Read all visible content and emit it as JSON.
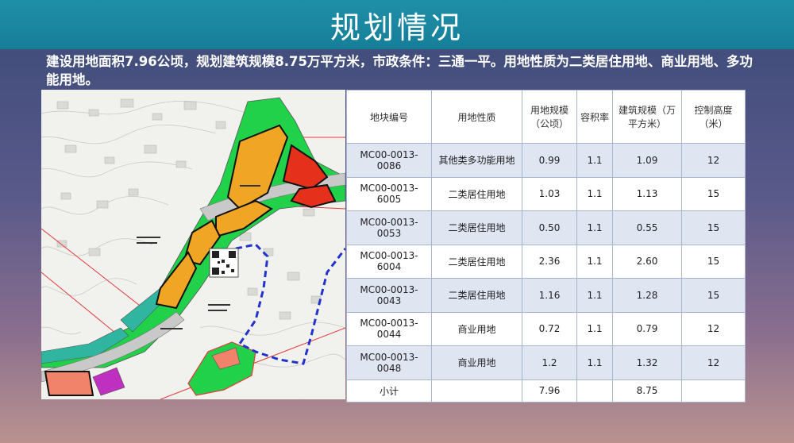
{
  "title": "规划情况",
  "description": "建设用地面积7.96公顷，规划建筑规模8.75万平方米，市政条件：三通一平。用地性质为二类居住用地、商业用地、多功能用地。",
  "table": {
    "headers": [
      "地块编号",
      "用地性质",
      "用地规模（公顷）",
      "容积率",
      "建筑规模（万平方米）",
      "控制高度（米）"
    ],
    "rows": [
      {
        "code": "MC00-0013-0086",
        "type": "其他类多功能用地",
        "area": "0.99",
        "far": "1.1",
        "gfa": "1.09",
        "height": "12"
      },
      {
        "code": "MC00-0013-6005",
        "type": "二类居住用地",
        "area": "1.03",
        "far": "1.1",
        "gfa": "1.13",
        "height": "15"
      },
      {
        "code": "MC00-0013-0053",
        "type": "二类居住用地",
        "area": "0.50",
        "far": "1.1",
        "gfa": "0.55",
        "height": "15"
      },
      {
        "code": "MC00-0013-6004",
        "type": "二类居住用地",
        "area": "2.36",
        "far": "1.1",
        "gfa": "2.60",
        "height": "15"
      },
      {
        "code": "MC00-0013-0043",
        "type": "二类居住用地",
        "area": "1.16",
        "far": "1.1",
        "gfa": "1.28",
        "height": "15"
      },
      {
        "code": "MC00-0013-0044",
        "type": "商业用地",
        "area": "0.72",
        "far": "1.1",
        "gfa": "0.79",
        "height": "12"
      },
      {
        "code": "MC00-0013-0048",
        "type": "商业用地",
        "area": "1.2",
        "far": "1.1",
        "gfa": "1.32",
        "height": "12"
      }
    ],
    "subtotal": {
      "label": "小计",
      "area": "7.96",
      "gfa": "8.75"
    }
  },
  "colors": {
    "title_bar": "#1f8fa8",
    "green_land": "#22d14a",
    "residential": "#f0a624",
    "commercial": "#e5301c",
    "road": "#c9c9c9",
    "boundary_blue": "#2233cc",
    "table_stripe": "#dfe6f2"
  }
}
